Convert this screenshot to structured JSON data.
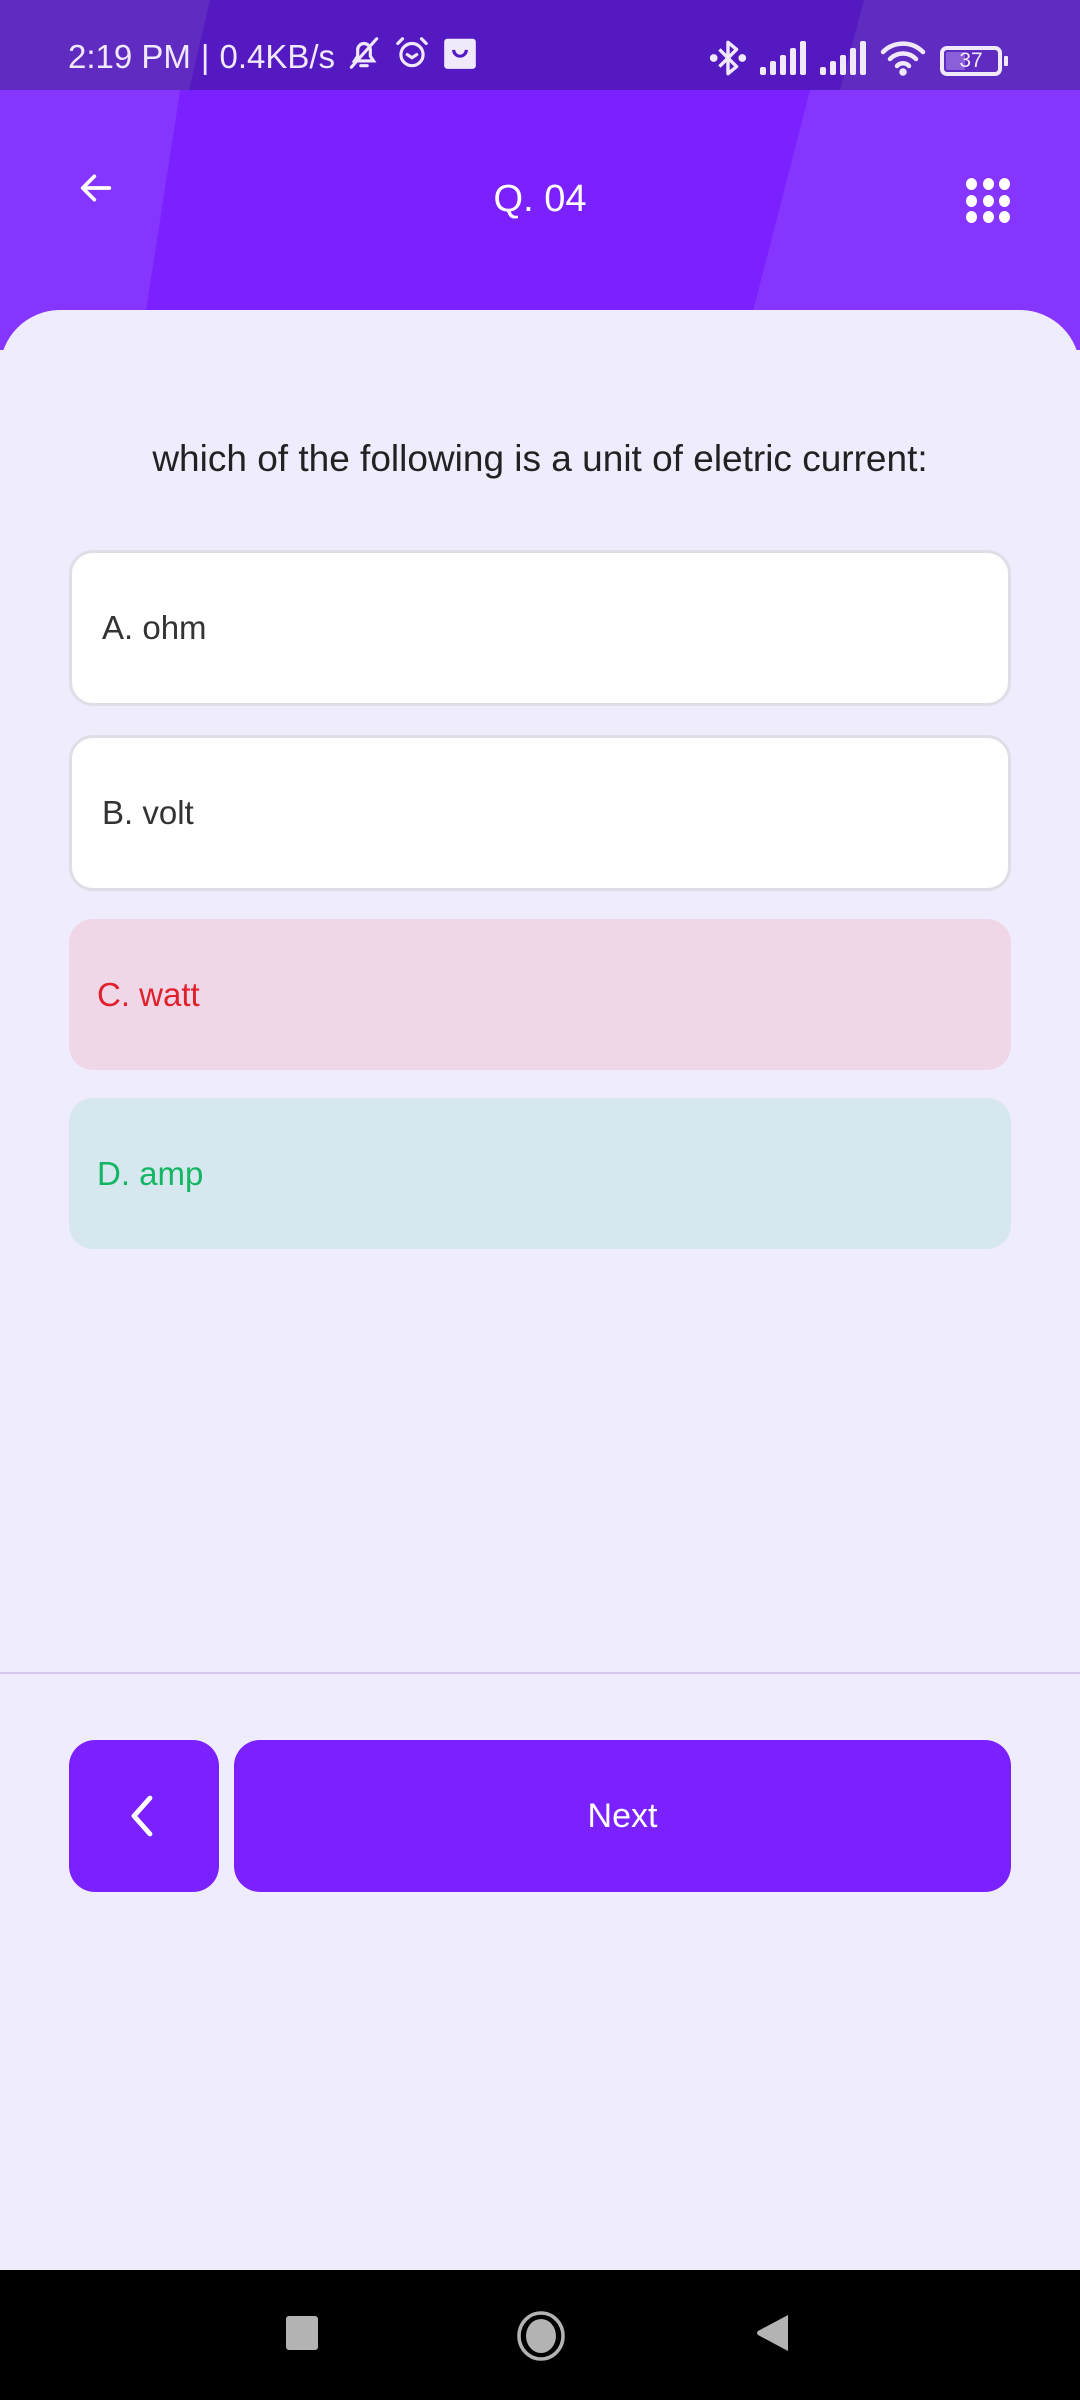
{
  "status_bar": {
    "time": "2:19 PM",
    "separator": "|",
    "net_speed": "0.4KB/s",
    "left_icons": [
      "bell-off-icon",
      "alarm-icon",
      "shopping-bag-icon"
    ],
    "right_icons": [
      "bluetooth-icon",
      "signal-icon",
      "signal-icon",
      "wifi-icon"
    ],
    "battery_level": "37"
  },
  "header": {
    "back_icon": "arrow-left-icon",
    "title": "Q. 04",
    "grid_icon": "grid-menu-icon"
  },
  "question": {
    "text": "which of the following is a unit of eletric current:"
  },
  "options": [
    {
      "label": "A. ohm",
      "state": "default"
    },
    {
      "label": "B. volt",
      "state": "default"
    },
    {
      "label": "C. watt",
      "state": "wrong"
    },
    {
      "label": "D. amp",
      "state": "correct"
    }
  ],
  "footer": {
    "prev_icon": "chevron-left-icon",
    "next_label": "Next"
  },
  "colors": {
    "primary": "#7b20ff",
    "wrong_text": "#e0202a",
    "wrong_bg": "#efd7e8",
    "correct_text": "#13b662",
    "correct_bg": "#d7e7ef",
    "background": "#efecfd"
  },
  "nav_bar": {
    "buttons": [
      "recents-icon",
      "home-icon",
      "back-icon"
    ]
  }
}
